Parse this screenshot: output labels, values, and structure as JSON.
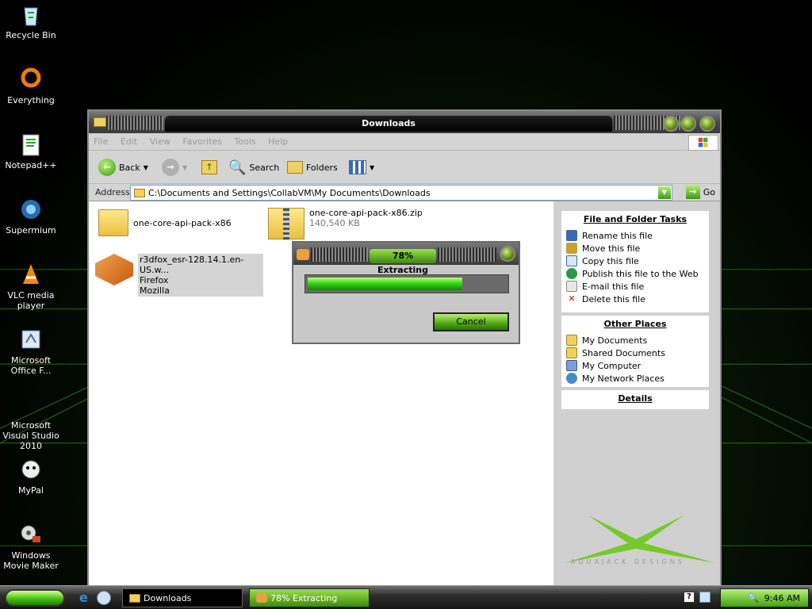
{
  "desktop": {
    "icons": [
      {
        "label": "Recycle Bin",
        "icon": "recycle-bin-icon"
      },
      {
        "label": "Everything",
        "icon": "everything-icon"
      },
      {
        "label": "Notepad++",
        "icon": "notepad-plus-plus-icon"
      },
      {
        "label": "Supermium",
        "icon": "supermium-icon"
      },
      {
        "label": "VLC media player",
        "icon": "vlc-icon"
      },
      {
        "label": "Microsoft Office F...",
        "icon": "office-icon"
      },
      {
        "label": "Microsoft Visual Studio 2010",
        "icon": "visual-studio-icon"
      },
      {
        "label": "MyPal",
        "icon": "mypal-icon"
      },
      {
        "label": "Windows Movie Maker",
        "icon": "movie-maker-icon"
      }
    ]
  },
  "window": {
    "title": "Downloads",
    "menu": [
      "File",
      "Edit",
      "View",
      "Favorites",
      "Tools",
      "Help"
    ],
    "toolbar": {
      "back": "Back",
      "search": "Search",
      "folders": "Folders"
    },
    "address": {
      "label": "Address",
      "value": "C:\\Documents and Settings\\CollabVM\\My Documents\\Downloads",
      "go": "Go"
    },
    "files": [
      {
        "name": "one-core-api-pack-x86",
        "detail1": "",
        "detail2": ""
      },
      {
        "name": "one-core-api-pack-x86.zip",
        "detail1": "140,540 KB",
        "detail2": ""
      },
      {
        "name": "r3dfox_esr-128.14.1.en-US.w...",
        "detail1": "Firefox",
        "detail2": "Mozilla"
      }
    ],
    "tasks": {
      "title": "File and Folder Tasks",
      "items": [
        "Rename this file",
        "Move this file",
        "Copy this file",
        "Publish this file to the Web",
        "E-mail this file",
        "Delete this file"
      ]
    },
    "other_places": {
      "title": "Other Places",
      "items": [
        "My Documents",
        "Shared Documents",
        "My Computer",
        "My Network Places"
      ]
    },
    "details_title": "Details",
    "watermark": "AQUAJACK DESIGNS"
  },
  "dialog": {
    "title": "78% Extracting",
    "progress": 0.78,
    "cancel": "Cancel"
  },
  "taskbar": {
    "items": [
      "Downloads",
      "78% Extracting"
    ],
    "clock": "9:46 AM"
  },
  "colors": {
    "accent": "#52c818",
    "title_bg": "#3a3a3a"
  }
}
